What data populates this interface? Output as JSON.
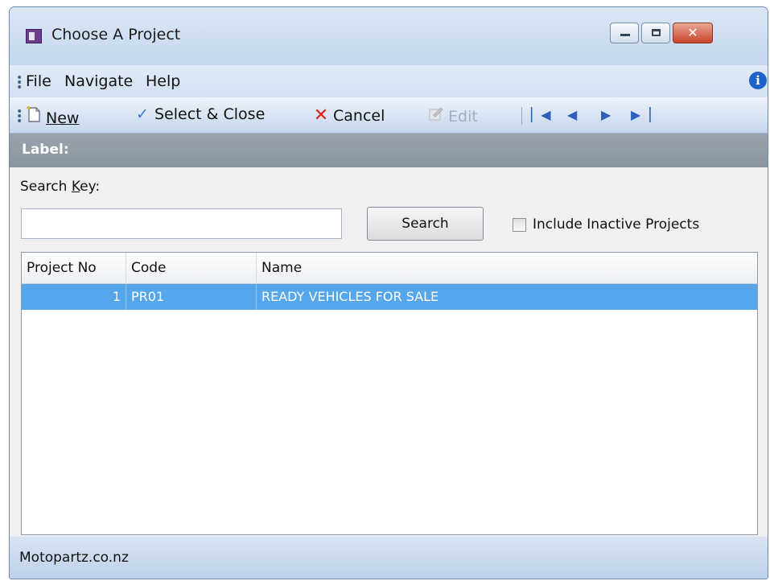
{
  "window": {
    "title": "Choose A Project"
  },
  "menu": {
    "items": [
      "File",
      "Navigate",
      "Help"
    ]
  },
  "toolbar": {
    "new_label": "New",
    "select_close_label": "Select & Close",
    "cancel_label": "Cancel",
    "edit_label": "Edit"
  },
  "label_bar": {
    "text": "Label:"
  },
  "search": {
    "label_pre": "Search ",
    "label_key": "K",
    "label_post": "ey:",
    "value": "",
    "button_label": "Search",
    "include_inactive_label": "Include Inactive Projects",
    "include_inactive_checked": false
  },
  "table": {
    "columns": [
      "Project No",
      "Code",
      "Name"
    ],
    "rows": [
      {
        "project_no": "1",
        "code": "PR01",
        "name": "READY VEHICLES FOR SALE",
        "selected": true
      }
    ]
  },
  "status": {
    "text": "Motopartz.co.nz"
  },
  "icons": {
    "app": "project-app-icon",
    "new": "new-document-icon",
    "select": "checkmark-icon",
    "cancel": "cancel-x-icon",
    "edit": "edit-icon",
    "first": "first-record-icon",
    "prev": "previous-record-icon",
    "next": "next-record-icon",
    "last": "last-record-icon",
    "info": "info-icon"
  },
  "colors": {
    "selection": "#56a6ec",
    "label_bar": "#8e98a3",
    "nav_icons": "#2d62b8",
    "cancel_icon": "#e0201b",
    "check_icon": "#3a7ad0"
  }
}
